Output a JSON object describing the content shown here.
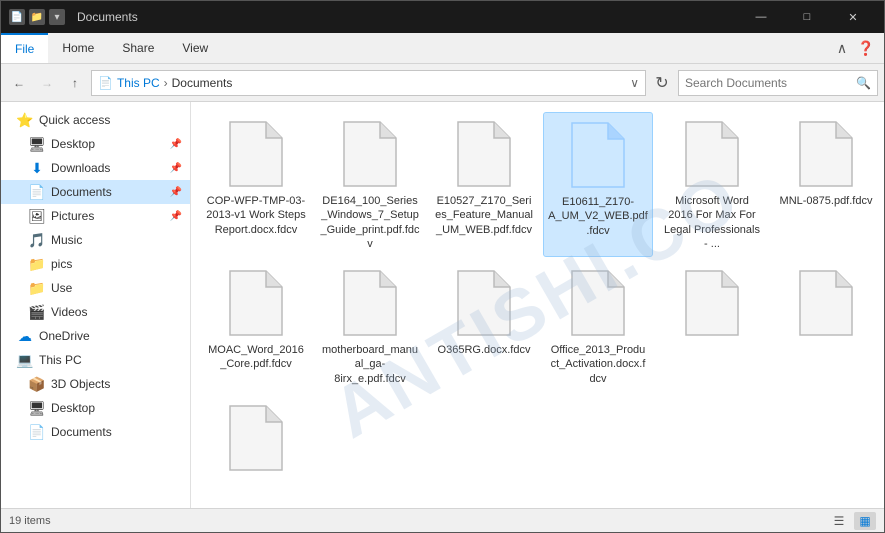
{
  "window": {
    "title": "Documents",
    "title_bar_icons": [
      "📄",
      "📁",
      "⬇"
    ],
    "controls": {
      "minimize": "—",
      "maximize": "□",
      "close": "✕"
    }
  },
  "ribbon": {
    "tabs": [
      {
        "id": "file",
        "label": "File",
        "active": true
      },
      {
        "id": "home",
        "label": "Home",
        "active": false
      },
      {
        "id": "share",
        "label": "Share",
        "active": false
      },
      {
        "id": "view",
        "label": "View",
        "active": false
      }
    ]
  },
  "address_bar": {
    "back": "←",
    "forward": "→",
    "up": "↑",
    "path": [
      "This PC",
      "Documents"
    ],
    "refresh": "↻",
    "search_placeholder": "Search Documents"
  },
  "sidebar": {
    "items": [
      {
        "id": "quick-access",
        "label": "Quick access",
        "icon": "⭐",
        "indent": 0
      },
      {
        "id": "desktop",
        "label": "Desktop",
        "icon": "🖥",
        "indent": 1,
        "pinned": true
      },
      {
        "id": "downloads",
        "label": "Downloads",
        "icon": "⬇",
        "indent": 1,
        "pinned": true
      },
      {
        "id": "documents",
        "label": "Documents",
        "icon": "📄",
        "indent": 1,
        "pinned": true,
        "active": true
      },
      {
        "id": "pictures",
        "label": "Pictures",
        "icon": "🖼",
        "indent": 1,
        "pinned": true
      },
      {
        "id": "music",
        "label": "Music",
        "icon": "🎵",
        "indent": 1
      },
      {
        "id": "pics",
        "label": "pics",
        "icon": "📁",
        "indent": 1
      },
      {
        "id": "use",
        "label": "Use",
        "icon": "📁",
        "indent": 1
      },
      {
        "id": "videos",
        "label": "Videos",
        "icon": "🎬",
        "indent": 1
      },
      {
        "id": "onedrive",
        "label": "OneDrive",
        "icon": "☁",
        "indent": 0
      },
      {
        "id": "this-pc",
        "label": "This PC",
        "icon": "💻",
        "indent": 0
      },
      {
        "id": "3d-objects",
        "label": "3D Objects",
        "icon": "📦",
        "indent": 1
      },
      {
        "id": "desktop2",
        "label": "Desktop",
        "icon": "🖥",
        "indent": 1
      },
      {
        "id": "documents2",
        "label": "Documents",
        "icon": "📄",
        "indent": 1
      }
    ]
  },
  "files": [
    {
      "id": "file1",
      "name": "COP-WFP-TMP-03-2013-v1 Work Steps Report.docx.fdcv",
      "selected": false
    },
    {
      "id": "file2",
      "name": "DE164_100_Series_Windows_7_Setup_Guide_print.pdf.fdcv",
      "selected": false
    },
    {
      "id": "file3",
      "name": "E10527_Z170_Series_Feature_Manual_UM_WEB.pdf.fdcv",
      "selected": false
    },
    {
      "id": "file4",
      "name": "E10611_Z170-A_UM_V2_WEB.pdf.fdcv",
      "selected": true
    },
    {
      "id": "file5",
      "name": "Microsoft Word 2016 For Max For Legal Professionals - ...",
      "selected": false
    },
    {
      "id": "file6",
      "name": "MNL-0875.pdf.fdcv",
      "selected": false
    },
    {
      "id": "file7",
      "name": "MOAC_Word_2016_Core.pdf.fdcv",
      "selected": false
    },
    {
      "id": "file8",
      "name": "motherboard_manual_ga-8irx_e.pdf.fdcv",
      "selected": false
    },
    {
      "id": "file9",
      "name": "O365RG.docx.fdcv",
      "selected": false
    },
    {
      "id": "file10",
      "name": "Office_2013_Product_Activation.docx.fdcv",
      "selected": false
    },
    {
      "id": "file11",
      "name": "",
      "selected": false
    },
    {
      "id": "file12",
      "name": "",
      "selected": false
    },
    {
      "id": "file13",
      "name": "",
      "selected": false
    }
  ],
  "status_bar": {
    "count": "19 items",
    "view_list": "☰",
    "view_detail": "≣",
    "view_grid": "⊞"
  },
  "watermark": "ANTISHI.CO"
}
